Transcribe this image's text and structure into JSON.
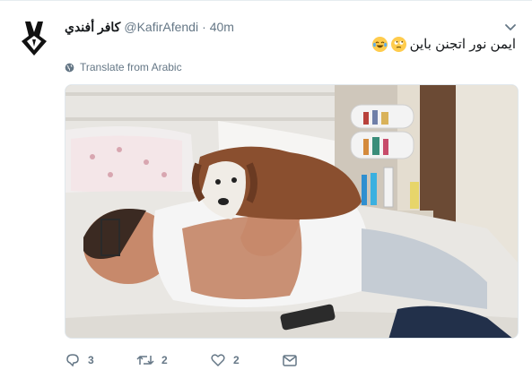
{
  "tweet": {
    "display_name": "كافر أفندي",
    "username": "@KafirAfendi",
    "separator": "·",
    "time": "40m",
    "text": "ايمن نور اتجنن باين",
    "emojis": [
      "laughing-tears",
      "rolling-eyes"
    ],
    "translate_label": "Translate from Arabic",
    "image_alt": "Man lying on a bed with a Saint Bernard puppy on his chest"
  },
  "actions": {
    "reply_count": "3",
    "retweet_count": "2",
    "like_count": "2"
  },
  "icons": {
    "reply": "reply-icon",
    "retweet": "retweet-icon",
    "like": "heart-icon",
    "dm": "mail-icon",
    "globe": "globe-icon",
    "chevron": "chevron-down-icon"
  },
  "colors": {
    "text": "#14171a",
    "muted": "#657786",
    "border": "#e6ecf0"
  }
}
